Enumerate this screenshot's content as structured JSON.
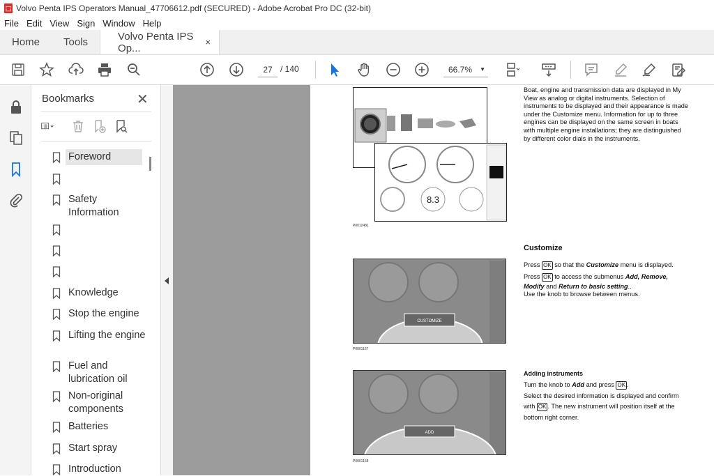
{
  "window": {
    "title": "Volvo Penta IPS Operators Manual_47706612.pdf (SECURED) - Adobe Acrobat Pro DC (32-bit)"
  },
  "menu": [
    "File",
    "Edit",
    "View",
    "Sign",
    "Window",
    "Help"
  ],
  "tabs": {
    "home": "Home",
    "tools": "Tools",
    "document": "Volvo Penta IPS Op...",
    "close": "×"
  },
  "toolbar": {
    "page_current": "27",
    "page_total": "/  140",
    "zoom": "66.7%"
  },
  "bookmarks": {
    "title": "Bookmarks",
    "close": "✕",
    "items": [
      "Foreword",
      "",
      "Safety Information",
      "",
      "",
      "",
      "Knowledge",
      "Stop the engine",
      "Lifting the engine",
      "Fuel and lubrication oil",
      "Non-original components",
      "Batteries",
      "Start spray",
      "Introduction"
    ]
  },
  "pdf": {
    "intro_text": "Boat, engine and transmission data are displayed in My View as analog or digital instruments. Selection of instruments to be displayed and their appearance is made under the Customize menu. Information for up to three engines can be displayed on the same screen in boats with multiple engine installations; they are distinguished by different color dials in the instruments.",
    "fig1_caption": "P0012481",
    "customize_heading": "Customize",
    "customize_p1a": "Press",
    "customize_p1b": "so that the",
    "customize_p1c": "Customize",
    "customize_p1d": "menu is displayed.",
    "customize_p2a": "Press",
    "customize_p2b": "to access the submenus",
    "customize_p2c": "Add, Remove,",
    "customize_p2d": "Modify",
    "customize_p2e": "and",
    "customize_p2f": "Return to basic setting",
    "customize_p3": "Use the knob to browse between menus.",
    "ok": "OK",
    "fig2_caption": "P0001167",
    "adding_heading": "Adding instruments",
    "adding_p1a": "Turn the knob to",
    "adding_p1b": "Add",
    "adding_p1c": "and press",
    "adding_p2": "Select the desired information is displayed and confirm",
    "adding_p3a": "with",
    "adding_p3b": ". The new instrument will position itself at the",
    "adding_p3c": "bottom right corner.",
    "fig3_caption": "P0001168",
    "menu_customize": "CUSTOMIZE",
    "menu_add": "ADD",
    "depth_value": "8.3"
  },
  "colors": {
    "accent": "#1473e6",
    "pdf_icon": "#d3312c",
    "viewer_bg": "#9c9c9c"
  }
}
